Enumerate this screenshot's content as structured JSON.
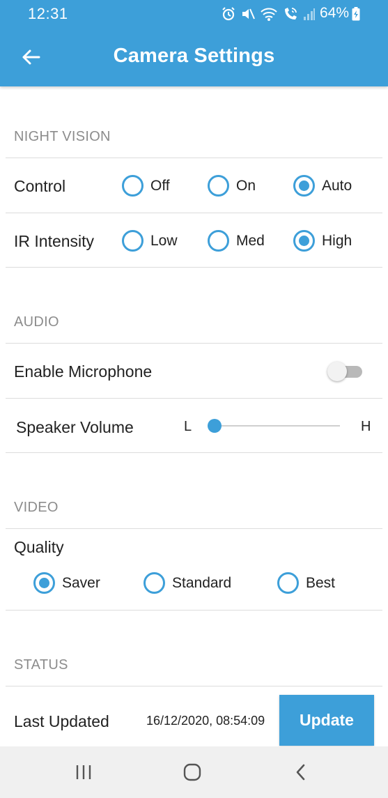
{
  "status_bar": {
    "time": "12:31",
    "battery": "64%",
    "icons": [
      "alarm-icon",
      "mute-icon",
      "wifi-icon",
      "wifi-calling-icon",
      "signal-icon",
      "battery-charging-icon"
    ]
  },
  "header": {
    "title": "Camera Settings",
    "back_icon": "arrow-left-icon"
  },
  "colors": {
    "accent": "#3d9fd9",
    "section_text": "#8c8c8c",
    "divider": "#dcdcdc",
    "nav_bar": "#f0f0f0"
  },
  "night_vision": {
    "section_title": "NIGHT VISION",
    "control": {
      "label": "Control",
      "options": [
        "Off",
        "On",
        "Auto"
      ],
      "selected": "Auto"
    },
    "ir_intensity": {
      "label": "IR Intensity",
      "options": [
        "Low",
        "Med",
        "High"
      ],
      "selected": "High"
    }
  },
  "audio": {
    "section_title": "AUDIO",
    "microphone": {
      "label": "Enable Microphone",
      "enabled": false
    },
    "speaker_volume": {
      "label": "Speaker Volume",
      "min_label": "L",
      "max_label": "H",
      "value_fraction": 0.05
    }
  },
  "video": {
    "section_title": "VIDEO",
    "quality": {
      "label": "Quality",
      "options": [
        "Saver",
        "Standard",
        "Best"
      ],
      "selected": "Saver"
    }
  },
  "status": {
    "section_title": "STATUS",
    "last_updated_label": "Last Updated",
    "last_updated_value": "16/12/2020, 08:54:09",
    "update_button": "Update"
  },
  "nav_bar": {
    "buttons": [
      "recent-apps-icon",
      "home-icon",
      "back-icon"
    ]
  }
}
